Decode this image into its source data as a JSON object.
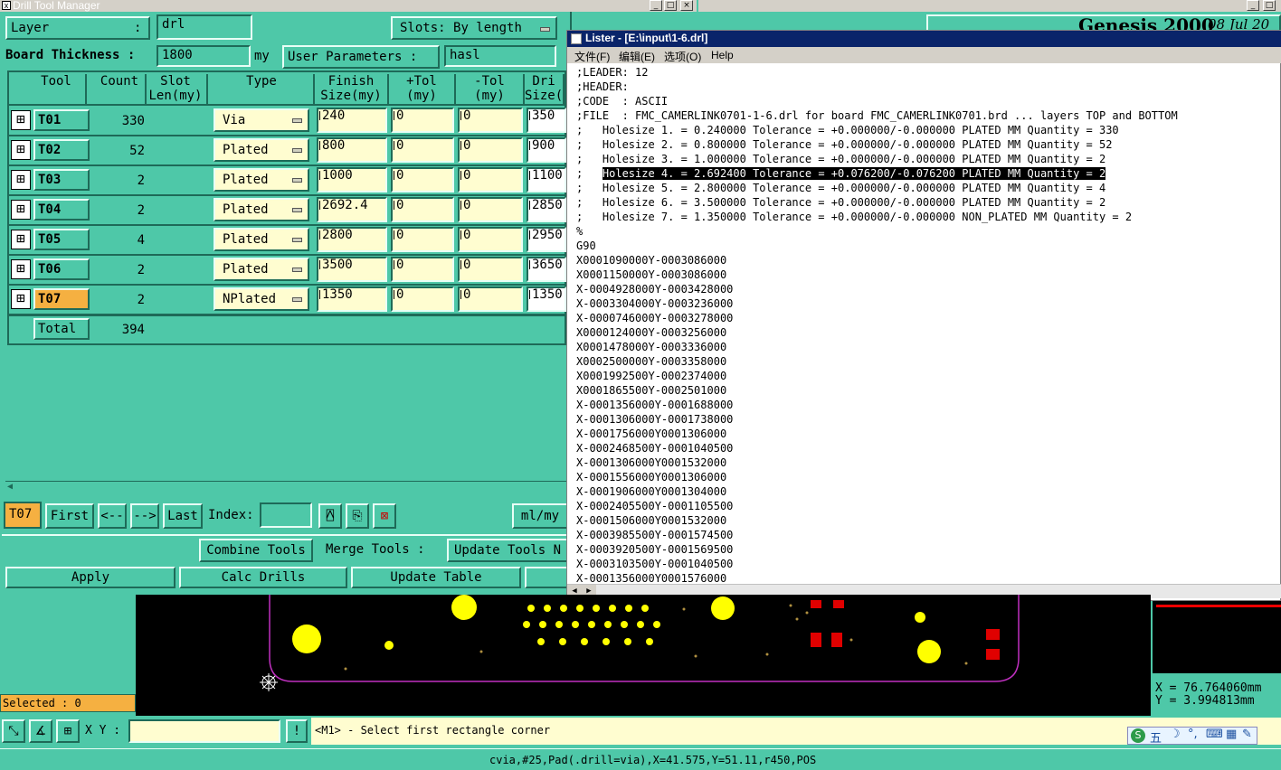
{
  "dtm": {
    "title": "Drill Tool Manager",
    "layer_label": "Layer",
    ":": ":",
    "layer_value": "drl",
    "slots_label": "Slots:",
    "slots_value": "By length",
    "board_thickness_label": "Board Thickness :",
    "board_thickness_value": "1800",
    "board_thickness_unit": "my",
    "user_params_label": "User Parameters :",
    "user_params_value": "hasl",
    "headers": [
      "Tool",
      "Count",
      "Slot\nLen(my)",
      "Type",
      "Finish\nSize(my)",
      "+Tol\n(my)",
      "-Tol\n(my)",
      "Dri\nSize("
    ],
    "rows": [
      {
        "tool": "T01",
        "count": "330",
        "type": "Via",
        "finish": "240",
        "ptol": "0",
        "mtol": "0",
        "drill": "350"
      },
      {
        "tool": "T02",
        "count": "52",
        "type": "Plated",
        "finish": "800",
        "ptol": "0",
        "mtol": "0",
        "drill": "900"
      },
      {
        "tool": "T03",
        "count": "2",
        "type": "Plated",
        "finish": "1000",
        "ptol": "0",
        "mtol": "0",
        "drill": "1100"
      },
      {
        "tool": "T04",
        "count": "2",
        "type": "Plated",
        "finish": "2692.4",
        "ptol": "0",
        "mtol": "0",
        "drill": "2850"
      },
      {
        "tool": "T05",
        "count": "4",
        "type": "Plated",
        "finish": "2800",
        "ptol": "0",
        "mtol": "0",
        "drill": "2950"
      },
      {
        "tool": "T06",
        "count": "2",
        "type": "Plated",
        "finish": "3500",
        "ptol": "0",
        "mtol": "0",
        "drill": "3650"
      },
      {
        "tool": "T07",
        "count": "2",
        "type": "NPlated",
        "finish": "1350",
        "ptol": "0",
        "mtol": "0",
        "drill": "1350"
      }
    ],
    "total_label": "Total",
    "total_count": "394",
    "current_tool": "T07",
    "first": "First",
    "prev": "<--",
    "next": "-->",
    "last": "Last",
    "index_label": "Index:",
    "units_button": "ml/my",
    "combine": "Combine Tools",
    "merge": "Merge Tools :",
    "update_tools": "Update Tools N",
    "apply": "Apply",
    "calc": "Calc Drills",
    "update_table": "Update Table"
  },
  "lister": {
    "title": "Lister - [E:\\input\\1-6.drl]",
    "menu": [
      "文件(F)",
      "编辑(E)",
      "选项(O)",
      "Help"
    ],
    "lines": [
      ";LEADER: 12",
      ";HEADER:",
      ";CODE  : ASCII",
      ";FILE  : FMC_CAMERLINK0701-1-6.drl for board FMC_CAMERLINK0701.brd ... layers TOP and BOTTOM",
      ";   Holesize 1. = 0.240000 Tolerance = +0.000000/-0.000000 PLATED MM Quantity = 330",
      ";   Holesize 2. = 0.800000 Tolerance = +0.000000/-0.000000 PLATED MM Quantity = 52",
      ";   Holesize 3. = 1.000000 Tolerance = +0.000000/-0.000000 PLATED MM Quantity = 2",
      ";   Holesize 4. = 2.692400 Tolerance = +0.076200/-0.076200 PLATED MM Quantity = 2",
      ";   Holesize 5. = 2.800000 Tolerance = +0.000000/-0.000000 PLATED MM Quantity = 4",
      ";   Holesize 6. = 3.500000 Tolerance = +0.000000/-0.000000 PLATED MM Quantity = 2",
      ";   Holesize 7. = 1.350000 Tolerance = +0.000000/-0.000000 NON_PLATED MM Quantity = 2",
      "%",
      "G90",
      "X0001090000Y-0003086000",
      "X0001150000Y-0003086000",
      "X-0004928000Y-0003428000",
      "X-0003304000Y-0003236000",
      "X-0000746000Y-0003278000",
      "X0000124000Y-0003256000",
      "X0001478000Y-0003336000",
      "X0002500000Y-0003358000",
      "X0001992500Y-0002374000",
      "X0001865500Y-0002501000",
      "X-0001356000Y-0001688000",
      "X-0001306000Y-0001738000",
      "X-0001756000Y0001306000",
      "X-0002468500Y-0001040500",
      "X-0001306000Y0001532000",
      "X-0001556000Y0001306000",
      "X-0001906000Y0001304000",
      "X-0002405500Y-0001105500",
      "X-0001506000Y0001532000",
      "X-0003985500Y-0001574500",
      "X-0003920500Y-0001569500",
      "X-0003103500Y-0001040500",
      "X-0001356000Y0001576000"
    ],
    "highlight": "Holesize 4. = 2.692400 Tolerance = +0.076200/-0.076200 PLATED MM Quantity = 2"
  },
  "genesis": {
    "title": "Genesis 2000",
    "date": "08 Jul 20",
    "x_readout": "X = 76.764060mm",
    "y_readout": "Y =  3.994813mm"
  },
  "bottom": {
    "selected": "Selected : 0",
    "xy_label": "X Y :",
    "prompt": "<M1> - Select first rectangle corner",
    "status": "cvia,#25,Pad(.drill=via),X=41.575,Y=51.11,r450,POS",
    "ime": "五"
  }
}
